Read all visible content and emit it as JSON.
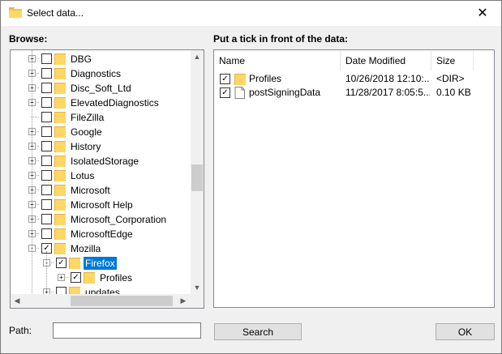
{
  "window": {
    "title": "Select data..."
  },
  "browse_label": "Browse:",
  "list_label": "Put a tick in front of the data:",
  "tree": {
    "items": [
      {
        "label": "DBG",
        "checked": false,
        "expander": "+",
        "level": 1
      },
      {
        "label": "Diagnostics",
        "checked": false,
        "expander": "+",
        "level": 1
      },
      {
        "label": "Disc_Soft_Ltd",
        "checked": false,
        "expander": "+",
        "level": 1
      },
      {
        "label": "ElevatedDiagnostics",
        "checked": false,
        "expander": "+",
        "level": 1
      },
      {
        "label": "FileZilla",
        "checked": false,
        "expander": "",
        "level": 1
      },
      {
        "label": "Google",
        "checked": false,
        "expander": "+",
        "level": 1
      },
      {
        "label": "History",
        "checked": false,
        "expander": "+",
        "level": 1
      },
      {
        "label": "IsolatedStorage",
        "checked": false,
        "expander": "+",
        "level": 1
      },
      {
        "label": "Lotus",
        "checked": false,
        "expander": "+",
        "level": 1
      },
      {
        "label": "Microsoft",
        "checked": false,
        "expander": "+",
        "level": 1
      },
      {
        "label": "Microsoft Help",
        "checked": false,
        "expander": "+",
        "level": 1
      },
      {
        "label": "Microsoft_Corporation",
        "checked": false,
        "expander": "+",
        "level": 1
      },
      {
        "label": "MicrosoftEdge",
        "checked": false,
        "expander": "+",
        "level": 1
      },
      {
        "label": "Mozilla",
        "checked": true,
        "expander": "-",
        "level": 1
      },
      {
        "label": "Firefox",
        "checked": true,
        "expander": "-",
        "level": 2,
        "selected": true
      },
      {
        "label": "Profiles",
        "checked": true,
        "expander": "+",
        "level": 3
      },
      {
        "label": "updates",
        "checked": false,
        "expander": "+",
        "level": 2
      }
    ]
  },
  "list": {
    "columns": [
      "Name",
      "Date Modified",
      "Size"
    ],
    "rows": [
      {
        "name": "Profiles",
        "date": "10/26/2018 12:10:...",
        "size": "<DIR>",
        "type": "folder",
        "checked": true
      },
      {
        "name": "postSigningData",
        "date": "11/28/2017 8:05:5...",
        "size": "0.10 KB",
        "type": "file",
        "checked": true
      }
    ]
  },
  "path": {
    "label": "Path:",
    "value": ""
  },
  "buttons": {
    "search": "Search",
    "ok": "OK"
  },
  "icons": {
    "close": "✕",
    "check": "✓",
    "up_arrow": "▲",
    "down_arrow": "▼",
    "left_arrow": "◀",
    "right_arrow": "▶"
  },
  "colors": {
    "selection": "#0078d7",
    "folder": "#ffd766",
    "folder_dark": "#e8b33a"
  }
}
